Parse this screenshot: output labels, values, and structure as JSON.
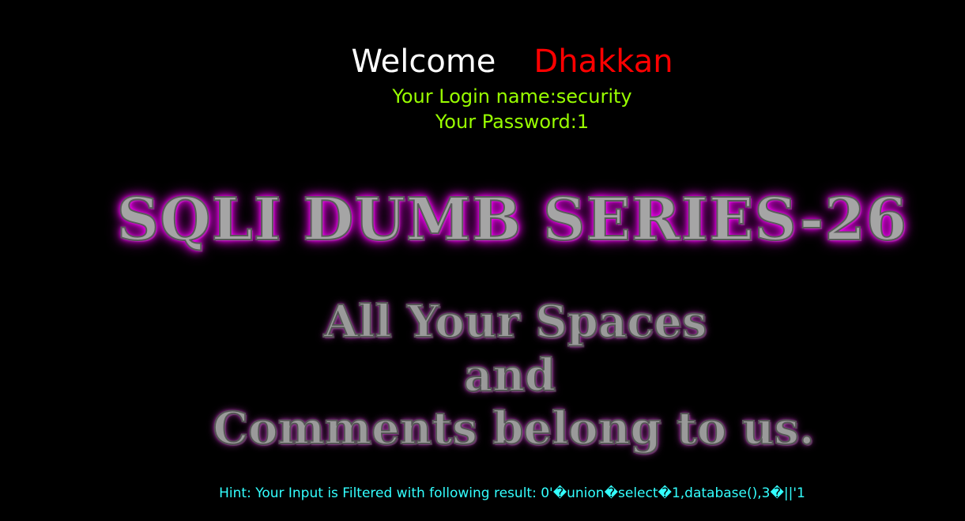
{
  "welcome": {
    "word": "Welcome",
    "name": "Dhakkan"
  },
  "login": {
    "name_line": "Your Login name:security",
    "password_line": "Your Password:1"
  },
  "banner": {
    "title": "SQLI DUMB SERIES-26",
    "tagline_1": "All Your Spaces",
    "tagline_2": "and",
    "tagline_3": "Comments belong to us."
  },
  "hint": {
    "text": "Hint: Your Input is Filtered with following result: 0'�union�select�1,database(),3�||'1"
  },
  "colors": {
    "background": "#000000",
    "welcome": "#ffffff",
    "name": "#ff0000",
    "login_text": "#99ff00",
    "hint_text": "#33ffff",
    "title_glow": "#ff00ff"
  }
}
